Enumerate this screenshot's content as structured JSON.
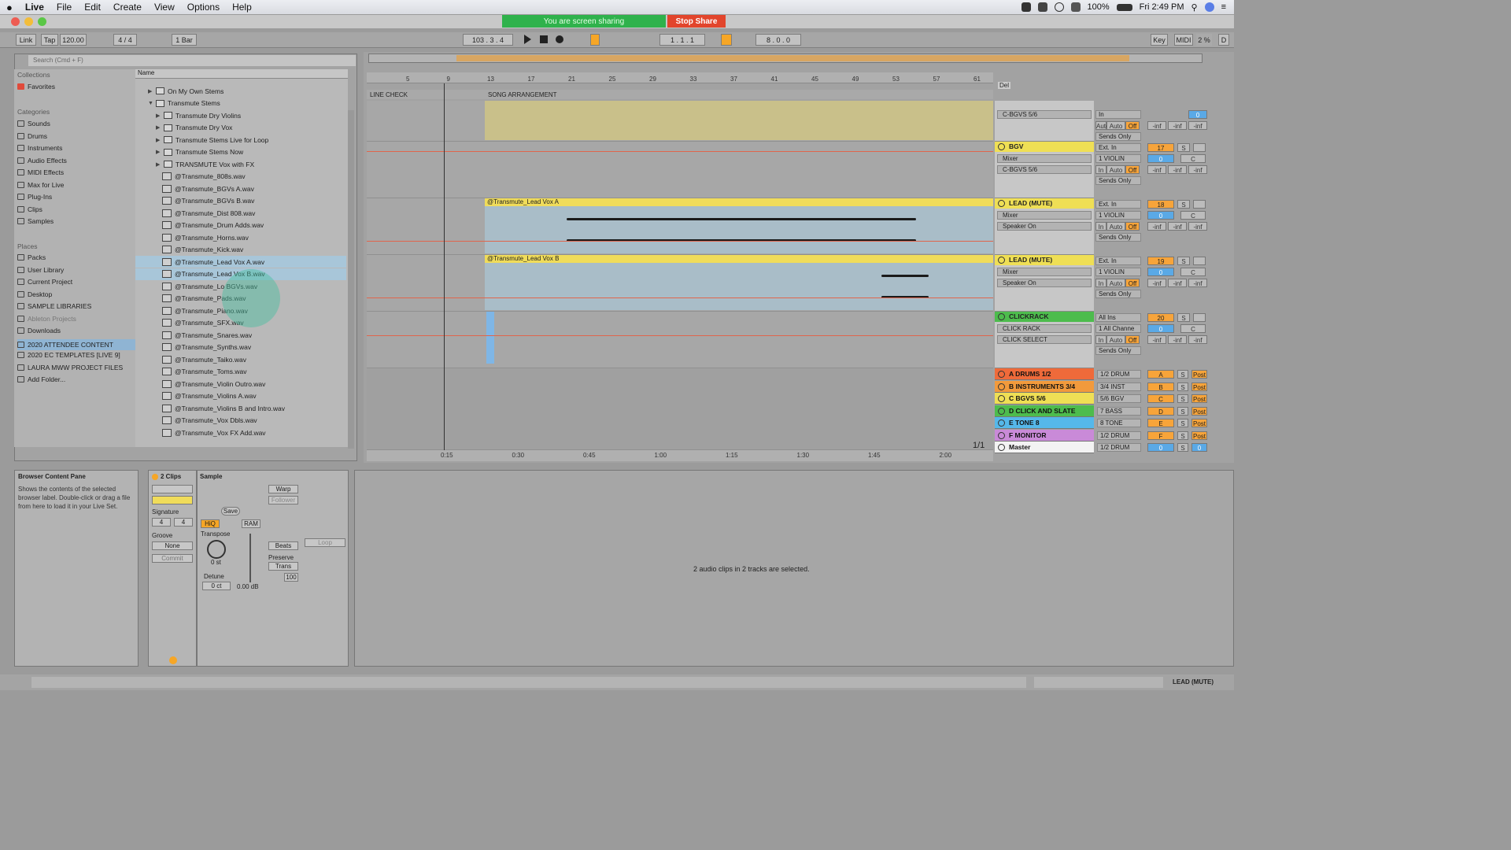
{
  "menubar": {
    "apple": "",
    "app": "Live",
    "items": [
      "File",
      "Edit",
      "Create",
      "View",
      "Options",
      "Help"
    ],
    "battery": "100%",
    "clock": "Fri 2:49 PM"
  },
  "sharing": {
    "status": "You are screen sharing",
    "stop_label": "Stop Share"
  },
  "transport": {
    "link": "Link",
    "tap": "Tap",
    "tempo": "120.00",
    "sig": "4 / 4",
    "quant": "1 Bar",
    "position": "103 . 3 . 4",
    "loop_start": "1 . 1 . 1",
    "loop_len": "8 . 0 . 0",
    "key": "Key",
    "midi": "MIDI",
    "cpu": "2 %",
    "d": "D"
  },
  "browser": {
    "search_placeholder": "Search (Cmd + F)",
    "collections_label": "Collections",
    "favorites": "Favorites",
    "categories_label": "Categories",
    "categories": [
      "Sounds",
      "Drums",
      "Instruments",
      "Audio Effects",
      "MIDI Effects",
      "Max for Live",
      "Plug-Ins",
      "Clips",
      "Samples"
    ],
    "places_label": "Places",
    "places": [
      "Packs",
      "User Library",
      "Current Project",
      "Desktop",
      "SAMPLE LIBRARIES",
      "Ableton Projects",
      "Downloads",
      "2020 ATTENDEE CONTENT",
      "2020 EC TEMPLATES [LIVE 9]",
      "LAURA MWW PROJECT FILES",
      "Add Folder..."
    ],
    "name_header": "Name",
    "folders": [
      "On My Own Stems",
      "Transmute Stems",
      "Transmute Dry Violins",
      "Transmute Dry Vox",
      "Transmute Stems Live for Loop",
      "Transmute Stems Now",
      "TRANSMUTE Vox with FX"
    ],
    "files": [
      "@Transmute_808s.wav",
      "@Transmute_BGVs A.wav",
      "@Transmute_BGVs B.wav",
      "@Transmute_Dist 808.wav",
      "@Transmute_Drum Adds.wav",
      "@Transmute_Horns.wav",
      "@Transmute_Kick.wav",
      "@Transmute_Lead Vox A.wav",
      "@Transmute_Lead Vox B.wav",
      "@Transmute_Lo BGVs.wav",
      "@Transmute_Pads.wav",
      "@Transmute_Piano.wav",
      "@Transmute_SFX.wav",
      "@Transmute_Snares.wav",
      "@Transmute_Synths.wav",
      "@Transmute_Taiko.wav",
      "@Transmute_Toms.wav",
      "@Transmute_Violin Outro.wav",
      "@Transmute_Violins A.wav",
      "@Transmute_Violins B and Intro.wav",
      "@Transmute_Vox Dbls.wav",
      "@Transmute_Vox FX Add.wav"
    ]
  },
  "arrangement": {
    "ruler": [
      "5",
      "9",
      "13",
      "17",
      "21",
      "25",
      "29",
      "33",
      "37",
      "41",
      "45",
      "49",
      "53",
      "57",
      "61"
    ],
    "locators": [
      "LINE CHECK",
      "SONG ARRANGEMENT"
    ],
    "time_ticks": [
      "0:15",
      "0:30",
      "0:45",
      "1:00",
      "1:15",
      "1:30",
      "1:45",
      "2:00"
    ],
    "page": "1/1",
    "del": "Del",
    "clips": [
      "@Transmute_Lead Vox A",
      "@Transmute_Lead Vox B"
    ]
  },
  "tracks": [
    {
      "name": "",
      "sub1": "C-BGVS 5/6",
      "io1": "In",
      "io2": "Auto",
      "io3": "Off",
      "sends": "Sends Only",
      "num": "",
      "vol": "0"
    },
    {
      "name": "BGV",
      "sub1": "Mixer",
      "sub2": "C-BGVS 5/6",
      "io0": "Ext. In",
      "io1": "1 VIOLIN",
      "io2": "In",
      "io3": "Auto",
      "io4": "Off",
      "sends": "Sends Only",
      "num": "17",
      "vol": "0",
      "pan": "C"
    },
    {
      "name": "LEAD (MUTE)",
      "sub1": "Mixer",
      "sub2": "Speaker On",
      "io0": "Ext. In",
      "io1": "1 VIOLIN",
      "io2": "In",
      "io3": "Auto",
      "io4": "Off",
      "sends": "Sends Only",
      "num": "18",
      "vol": "0",
      "pan": "C"
    },
    {
      "name": "LEAD (MUTE)",
      "sub1": "Mixer",
      "sub2": "Speaker On",
      "io0": "Ext. In",
      "io1": "1 VIOLIN",
      "io2": "In",
      "io3": "Auto",
      "io4": "Off",
      "sends": "Sends Only",
      "num": "19",
      "vol": "0",
      "pan": "C"
    },
    {
      "name": "CLICKRACK",
      "sub1": "CLICK RACK",
      "sub2": "CLICK SELECT",
      "io0": "All Ins",
      "io1": "1 All Channe",
      "io2": "In",
      "io3": "Auto",
      "io4": "Off",
      "sends": "Sends Only",
      "num": "20",
      "vol": "0",
      "pan": "C"
    }
  ],
  "returns": [
    {
      "name": "A DRUMS 1/2",
      "out": "1/2 DRUM",
      "letter": "A",
      "post": "Post",
      "color": "#ef6a3a"
    },
    {
      "name": "B INSTRUMENTS 3/4",
      "out": "3/4 INST",
      "letter": "B",
      "post": "Post",
      "color": "#f29a3c"
    },
    {
      "name": "C BGVS 5/6",
      "out": "5/6 BGV",
      "letter": "C",
      "post": "Post",
      "color": "#efdf55"
    },
    {
      "name": "D CLICK AND SLATE",
      "out": "7 BASS",
      "letter": "D",
      "post": "Post",
      "color": "#4dbc4d"
    },
    {
      "name": "E TONE 8",
      "out": "8 TONE",
      "letter": "E",
      "post": "Post",
      "color": "#55b8ea"
    },
    {
      "name": "F MONITOR",
      "out": "1/2 DRUM",
      "letter": "F",
      "post": "Post",
      "color": "#c98ad8"
    },
    {
      "name": "Master",
      "out": "1/2 DRUM",
      "letter": "0",
      "post": "0",
      "color": "#f3f3f3"
    }
  ],
  "solo": "S",
  "inf": "-inf",
  "detail": {
    "info_title": "Browser Content Pane",
    "info_text": "Shows the contents of the selected browser label. Double-click or drag a file from here to load it in your Live Set.",
    "clip_title": "2 Clips",
    "sample_title": "Sample",
    "signature": "Signature",
    "sig_n": "4",
    "sig_d": "4",
    "groove": "Groove",
    "groove_val": "None",
    "commit": "Commit",
    "save": "Save",
    "hiq": "HiQ",
    "ram": "RAM",
    "warp": "Warp",
    "follower": "Follower",
    "transpose": "Transpose",
    "transpose_val": "0 st",
    "detune": "Detune",
    "detune_val": "0 ct",
    "gain": "0.00 dB",
    "beats": "Beats",
    "preserve": "Preserve",
    "trans": "Trans",
    "loop": "Loop",
    "hundred": "100",
    "message": "2 audio clips in 2 tracks are selected."
  },
  "status": {
    "right": "LEAD (MUTE)"
  }
}
